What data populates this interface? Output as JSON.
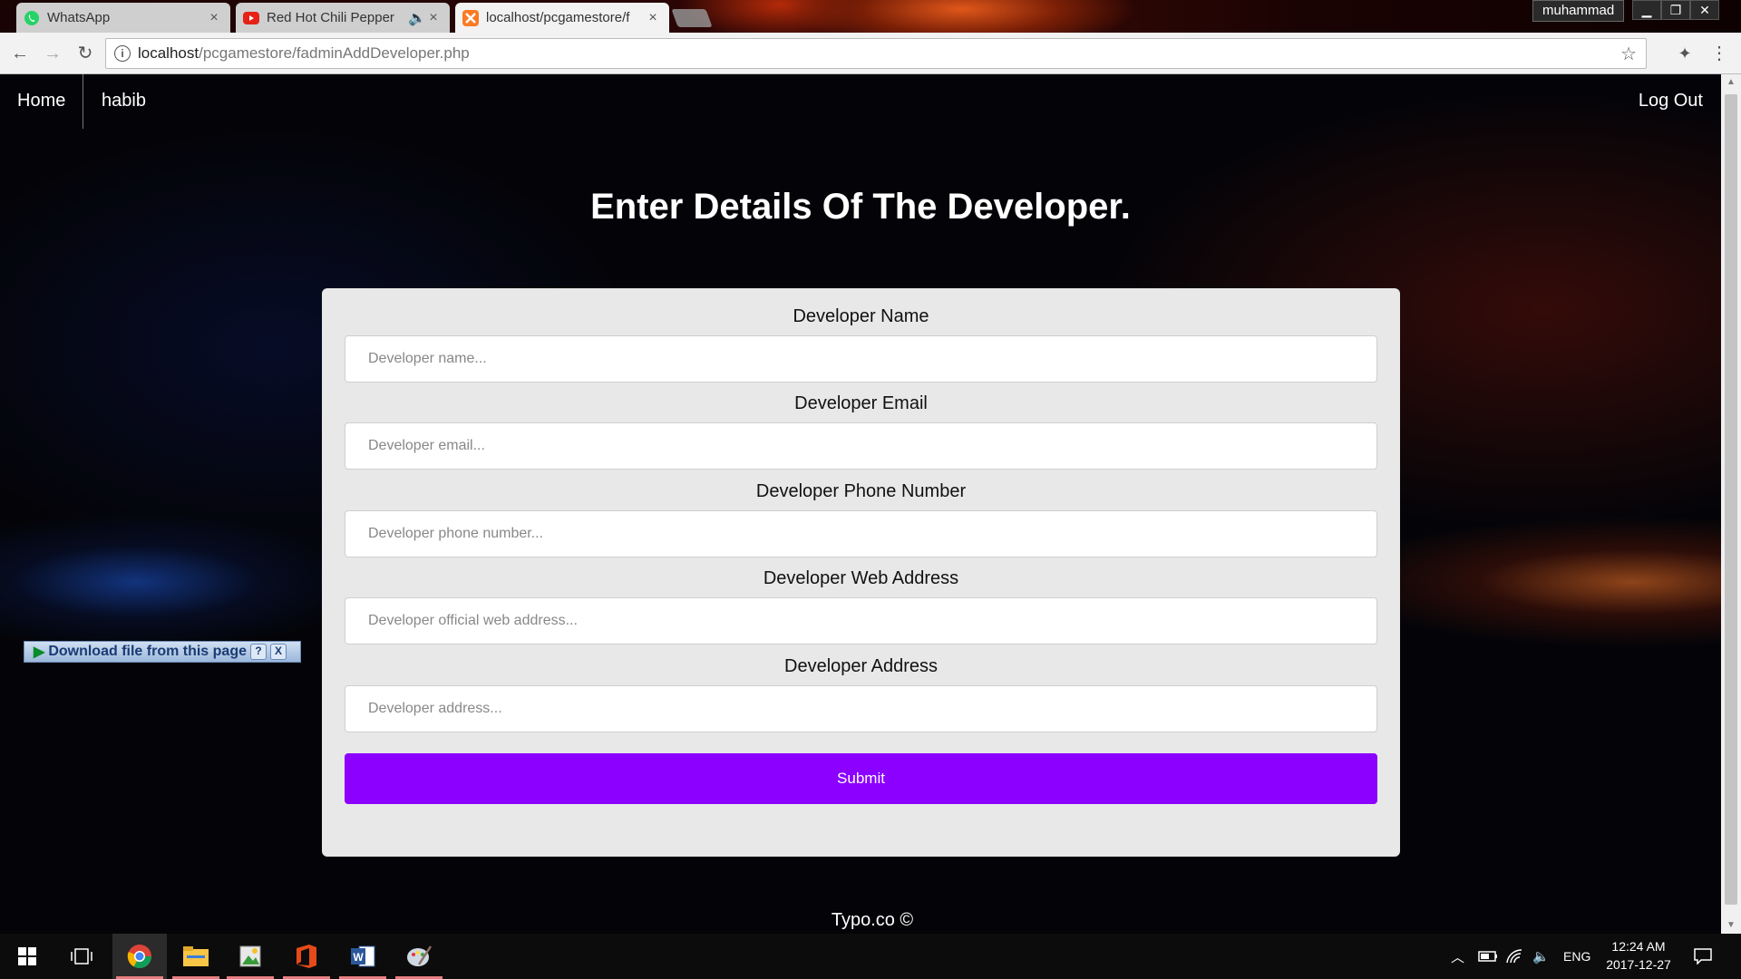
{
  "browser": {
    "tabs": [
      {
        "label": "WhatsApp",
        "favicon": "whatsapp-icon",
        "active": false
      },
      {
        "label": "Red Hot Chili Pepper",
        "favicon": "youtube-icon",
        "active": false,
        "audio": true
      },
      {
        "label": "localhost/pcgamestore/f",
        "favicon": "xampp-icon",
        "active": true
      }
    ],
    "profile_name": "muhammad",
    "url_host": "localhost",
    "url_path": "/pcgamestore/fadminAddDeveloper.php"
  },
  "nav": {
    "home": "Home",
    "user": "habib",
    "logout": "Log Out"
  },
  "page_title": "Enter Details Of The Developer.",
  "form": {
    "fields": [
      {
        "label": "Developer Name",
        "placeholder": "Developer name..."
      },
      {
        "label": "Developer Email",
        "placeholder": "Developer email..."
      },
      {
        "label": "Developer Phone Number",
        "placeholder": "Developer phone number..."
      },
      {
        "label": "Developer Web Address",
        "placeholder": "Developer official web address..."
      },
      {
        "label": "Developer Address",
        "placeholder": "Developer address..."
      }
    ],
    "submit": "Submit"
  },
  "footer": "Typo.co ©",
  "download_widget": {
    "label": "Download file from this page",
    "help": "?",
    "close": "X"
  },
  "taskbar": {
    "apps": [
      "chrome-icon",
      "file-explorer-icon",
      "image-app-icon",
      "office-icon",
      "word-icon",
      "paint-icon"
    ],
    "language": "ENG",
    "time": "12:24 AM",
    "date": "2017-12-27"
  },
  "colors": {
    "submit_bg": "#8b00ff",
    "card_bg": "#e8e8e8",
    "page_bg": "#040408"
  }
}
